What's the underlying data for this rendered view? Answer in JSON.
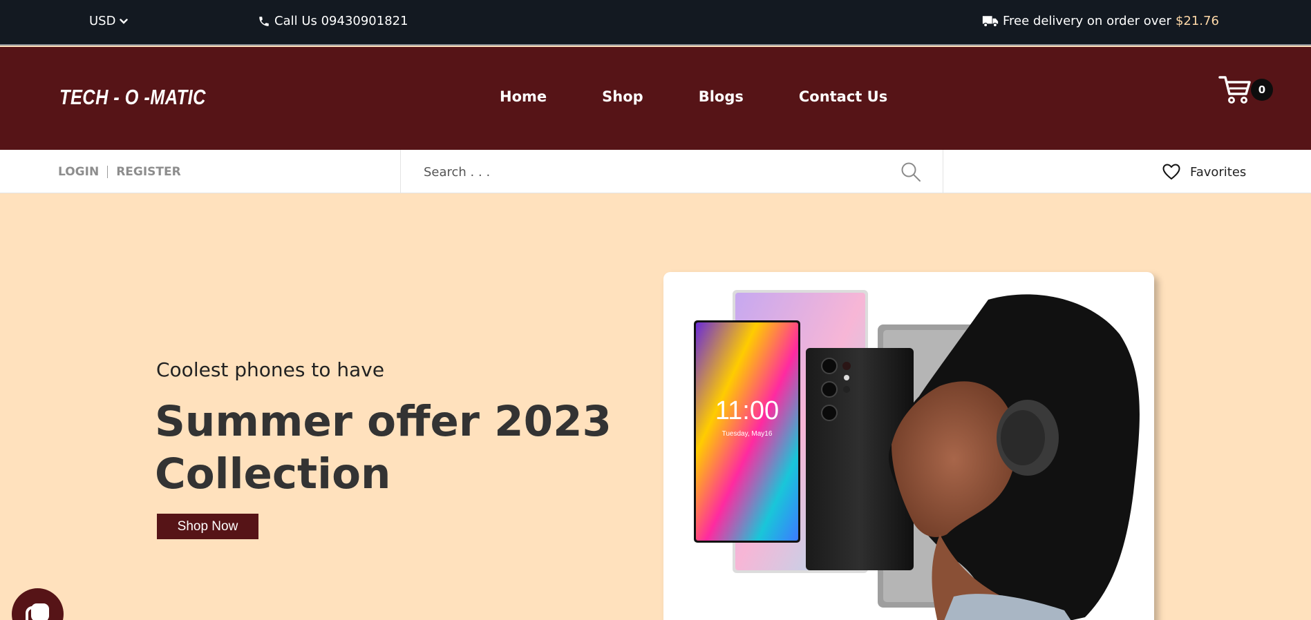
{
  "topbar": {
    "currency": "USD",
    "call_label": "Call Us 09430901821",
    "delivery_label": "Free delivery on order over",
    "delivery_amount": "$21.76"
  },
  "header": {
    "logo": "TECH - O -MATIC",
    "nav": [
      "Home",
      "Shop",
      "Blogs",
      "Contact Us"
    ],
    "cart_count": "0"
  },
  "subbar": {
    "login": "LOGIN",
    "register": "REGISTER",
    "search_placeholder": "Search . . .",
    "favorites": "Favorites"
  },
  "hero": {
    "subtitle": "Coolest phones to have",
    "title": "Summer offer 2023 Collection",
    "cta": "Shop Now",
    "phone_time": "11:00",
    "phone_date": "Tuesday, May16"
  },
  "colors": {
    "topbar_bg": "#131921",
    "header_bg": "#561417",
    "hero_bg": "#ffe1bd",
    "accent_price": "#ffd9a8"
  },
  "icons": [
    "chevron-down-icon",
    "phone-icon",
    "truck-icon",
    "cart-icon",
    "search-icon",
    "heart-icon",
    "chat-icon"
  ]
}
